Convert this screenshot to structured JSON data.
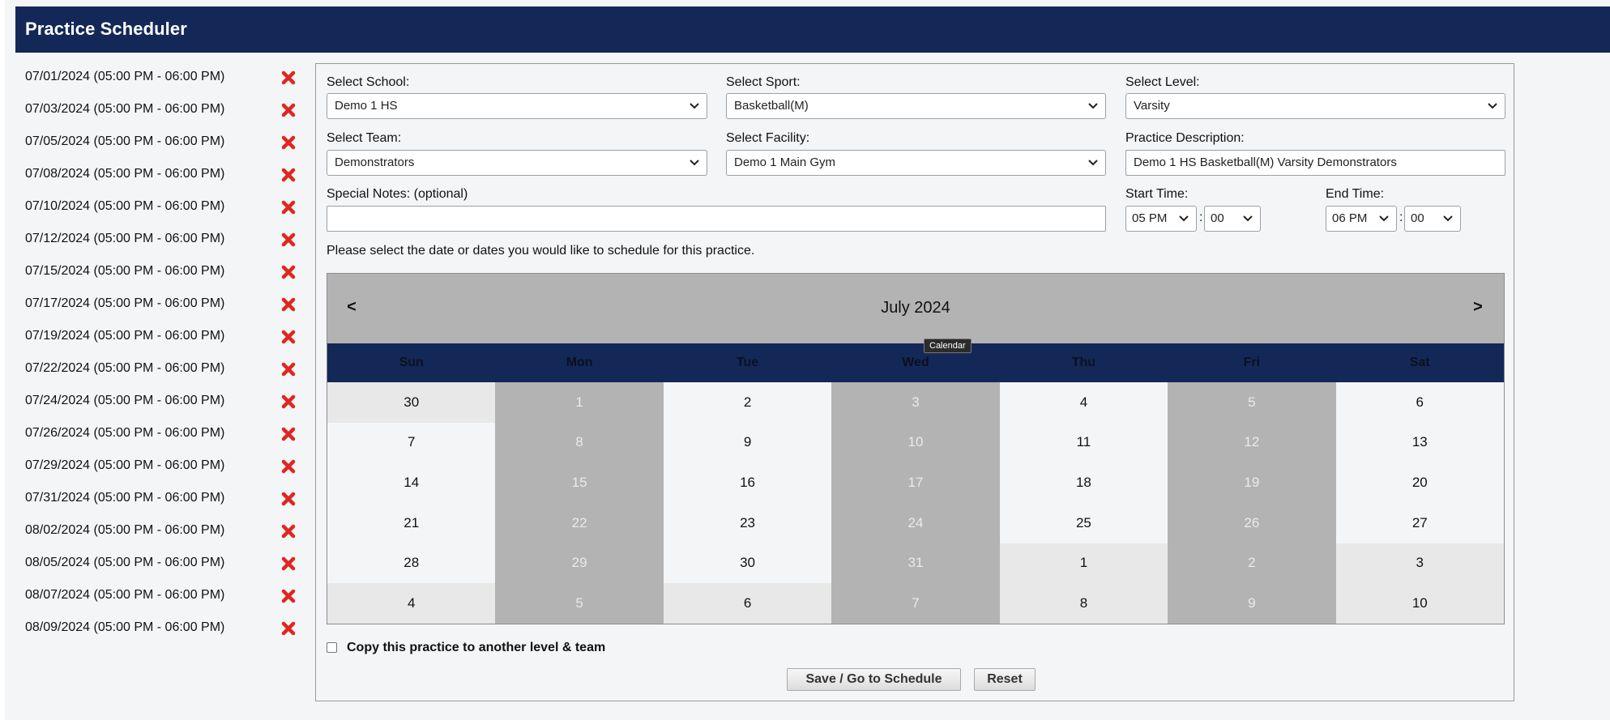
{
  "app": {
    "title": "Practice Scheduler"
  },
  "practices": [
    {
      "label": "07/01/2024 (05:00 PM - 06:00 PM)"
    },
    {
      "label": "07/03/2024 (05:00 PM - 06:00 PM)"
    },
    {
      "label": "07/05/2024 (05:00 PM - 06:00 PM)"
    },
    {
      "label": "07/08/2024 (05:00 PM - 06:00 PM)"
    },
    {
      "label": "07/10/2024 (05:00 PM - 06:00 PM)"
    },
    {
      "label": "07/12/2024 (05:00 PM - 06:00 PM)"
    },
    {
      "label": "07/15/2024 (05:00 PM - 06:00 PM)"
    },
    {
      "label": "07/17/2024 (05:00 PM - 06:00 PM)"
    },
    {
      "label": "07/19/2024 (05:00 PM - 06:00 PM)"
    },
    {
      "label": "07/22/2024 (05:00 PM - 06:00 PM)"
    },
    {
      "label": "07/24/2024 (05:00 PM - 06:00 PM)"
    },
    {
      "label": "07/26/2024 (05:00 PM - 06:00 PM)"
    },
    {
      "label": "07/29/2024 (05:00 PM - 06:00 PM)"
    },
    {
      "label": "07/31/2024 (05:00 PM - 06:00 PM)"
    },
    {
      "label": "08/02/2024 (05:00 PM - 06:00 PM)"
    },
    {
      "label": "08/05/2024 (05:00 PM - 06:00 PM)"
    },
    {
      "label": "08/07/2024 (05:00 PM - 06:00 PM)"
    },
    {
      "label": "08/09/2024 (05:00 PM - 06:00 PM)"
    }
  ],
  "remove_icon": "close-x-icon",
  "form": {
    "school_label": "Select School:",
    "school_value": "Demo 1 HS",
    "sport_label": "Select Sport:",
    "sport_value": "Basketball(M)",
    "level_label": "Select Level:",
    "level_value": "Varsity",
    "team_label": "Select Team:",
    "team_value": "Demonstrators",
    "facility_label": "Select Facility:",
    "facility_value": "Demo 1 Main Gym",
    "description_label": "Practice Description:",
    "description_value": "Demo 1 HS Basketball(M) Varsity Demonstrators",
    "notes_label": "Special Notes: (optional)",
    "notes_value": "",
    "start_label": "Start Time:",
    "start_hour": "05 PM",
    "start_min": "00",
    "end_label": "End Time:",
    "end_hour": "06 PM",
    "end_min": "00",
    "colon": ":",
    "instructions": "Please select the date or dates you would like to schedule for this practice."
  },
  "calendar": {
    "prev": "<",
    "next": ">",
    "title": "July 2024",
    "tooltip": "Calendar",
    "weekdays": [
      "Sun",
      "Mon",
      "Tue",
      "Wed",
      "Thu",
      "Fri",
      "Sat"
    ],
    "cells": [
      {
        "d": "30",
        "other": true,
        "sel": false
      },
      {
        "d": "1",
        "other": false,
        "sel": true
      },
      {
        "d": "2",
        "other": false,
        "sel": false
      },
      {
        "d": "3",
        "other": false,
        "sel": true
      },
      {
        "d": "4",
        "other": false,
        "sel": false
      },
      {
        "d": "5",
        "other": false,
        "sel": true
      },
      {
        "d": "6",
        "other": false,
        "sel": false
      },
      {
        "d": "7",
        "other": false,
        "sel": false
      },
      {
        "d": "8",
        "other": false,
        "sel": true
      },
      {
        "d": "9",
        "other": false,
        "sel": false
      },
      {
        "d": "10",
        "other": false,
        "sel": true
      },
      {
        "d": "11",
        "other": false,
        "sel": false
      },
      {
        "d": "12",
        "other": false,
        "sel": true
      },
      {
        "d": "13",
        "other": false,
        "sel": false
      },
      {
        "d": "14",
        "other": false,
        "sel": false
      },
      {
        "d": "15",
        "other": false,
        "sel": true
      },
      {
        "d": "16",
        "other": false,
        "sel": false
      },
      {
        "d": "17",
        "other": false,
        "sel": true
      },
      {
        "d": "18",
        "other": false,
        "sel": false
      },
      {
        "d": "19",
        "other": false,
        "sel": true
      },
      {
        "d": "20",
        "other": false,
        "sel": false
      },
      {
        "d": "21",
        "other": false,
        "sel": false
      },
      {
        "d": "22",
        "other": false,
        "sel": true
      },
      {
        "d": "23",
        "other": false,
        "sel": false
      },
      {
        "d": "24",
        "other": false,
        "sel": true
      },
      {
        "d": "25",
        "other": false,
        "sel": false
      },
      {
        "d": "26",
        "other": false,
        "sel": true
      },
      {
        "d": "27",
        "other": false,
        "sel": false
      },
      {
        "d": "28",
        "other": false,
        "sel": false
      },
      {
        "d": "29",
        "other": false,
        "sel": true
      },
      {
        "d": "30",
        "other": false,
        "sel": false
      },
      {
        "d": "31",
        "other": false,
        "sel": true
      },
      {
        "d": "1",
        "other": true,
        "sel": false
      },
      {
        "d": "2",
        "other": true,
        "sel": true
      },
      {
        "d": "3",
        "other": true,
        "sel": false
      },
      {
        "d": "4",
        "other": true,
        "sel": false
      },
      {
        "d": "5",
        "other": true,
        "sel": true
      },
      {
        "d": "6",
        "other": true,
        "sel": false
      },
      {
        "d": "7",
        "other": true,
        "sel": true
      },
      {
        "d": "8",
        "other": true,
        "sel": false
      },
      {
        "d": "9",
        "other": true,
        "sel": true
      },
      {
        "d": "10",
        "other": true,
        "sel": false
      }
    ]
  },
  "copy": {
    "checked": false,
    "label": "Copy this practice to another level & team"
  },
  "buttons": {
    "save": "Save / Go to Schedule",
    "reset": "Reset"
  },
  "colors": {
    "header": "#142857",
    "remove": "#e0261f",
    "selected_day": "#b3b3b3"
  }
}
